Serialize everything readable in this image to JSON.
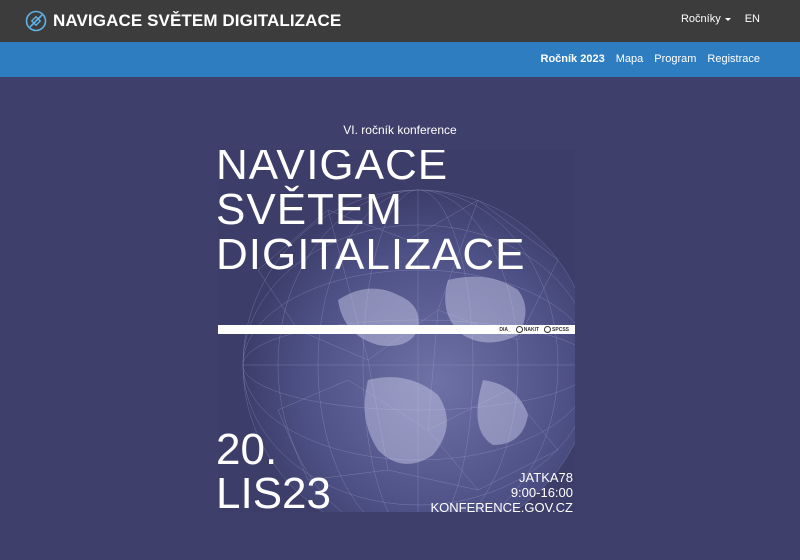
{
  "header": {
    "brand": "NAVIGACE SVĚTEM DIGITALIZACE",
    "rocniky_label": "Ročníky",
    "lang_label": "EN"
  },
  "nav": {
    "items": [
      {
        "label": "Ročník 2023",
        "active": true
      },
      {
        "label": "Mapa"
      },
      {
        "label": "Program"
      },
      {
        "label": "Registrace"
      }
    ]
  },
  "main": {
    "subtitle": "VI. ročník konference",
    "poster": {
      "title_lines": [
        "NAVIGACE",
        "SVĚTEM",
        "DIGITALIZACE"
      ],
      "sponsors": [
        "DIA_",
        "NAKIT",
        "SPCSS"
      ],
      "date_lines": [
        "20.",
        "LIS23"
      ],
      "venue_lines": [
        "JATKA78",
        "9:00-16:00",
        "KONFERENCE.GOV.CZ"
      ]
    }
  },
  "colors": {
    "topbar": "#3c3c3c",
    "navbar": "#2f7dc1",
    "background": "#3e3f6b"
  }
}
